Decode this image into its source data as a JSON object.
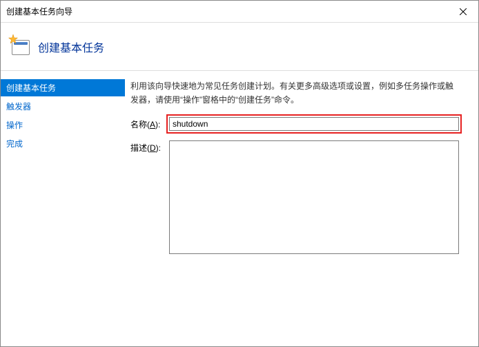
{
  "window": {
    "title": "创建基本任务向导"
  },
  "header": {
    "title": "创建基本任务"
  },
  "sidebar": {
    "items": [
      {
        "label": "创建基本任务",
        "active": true
      },
      {
        "label": "触发器",
        "active": false
      },
      {
        "label": "操作",
        "active": false
      },
      {
        "label": "完成",
        "active": false
      }
    ]
  },
  "main": {
    "intro": "利用该向导快速地为常见任务创建计划。有关更多高级选项或设置，例如多任务操作或触发器，请使用“操作”窗格中的“创建任务”命令。",
    "name_label_pre": "名称(",
    "name_label_accel": "A",
    "name_label_post": "):",
    "name_value": "shutdown",
    "desc_label_pre": "描述(",
    "desc_label_accel": "D",
    "desc_label_post": "):",
    "desc_value": ""
  }
}
